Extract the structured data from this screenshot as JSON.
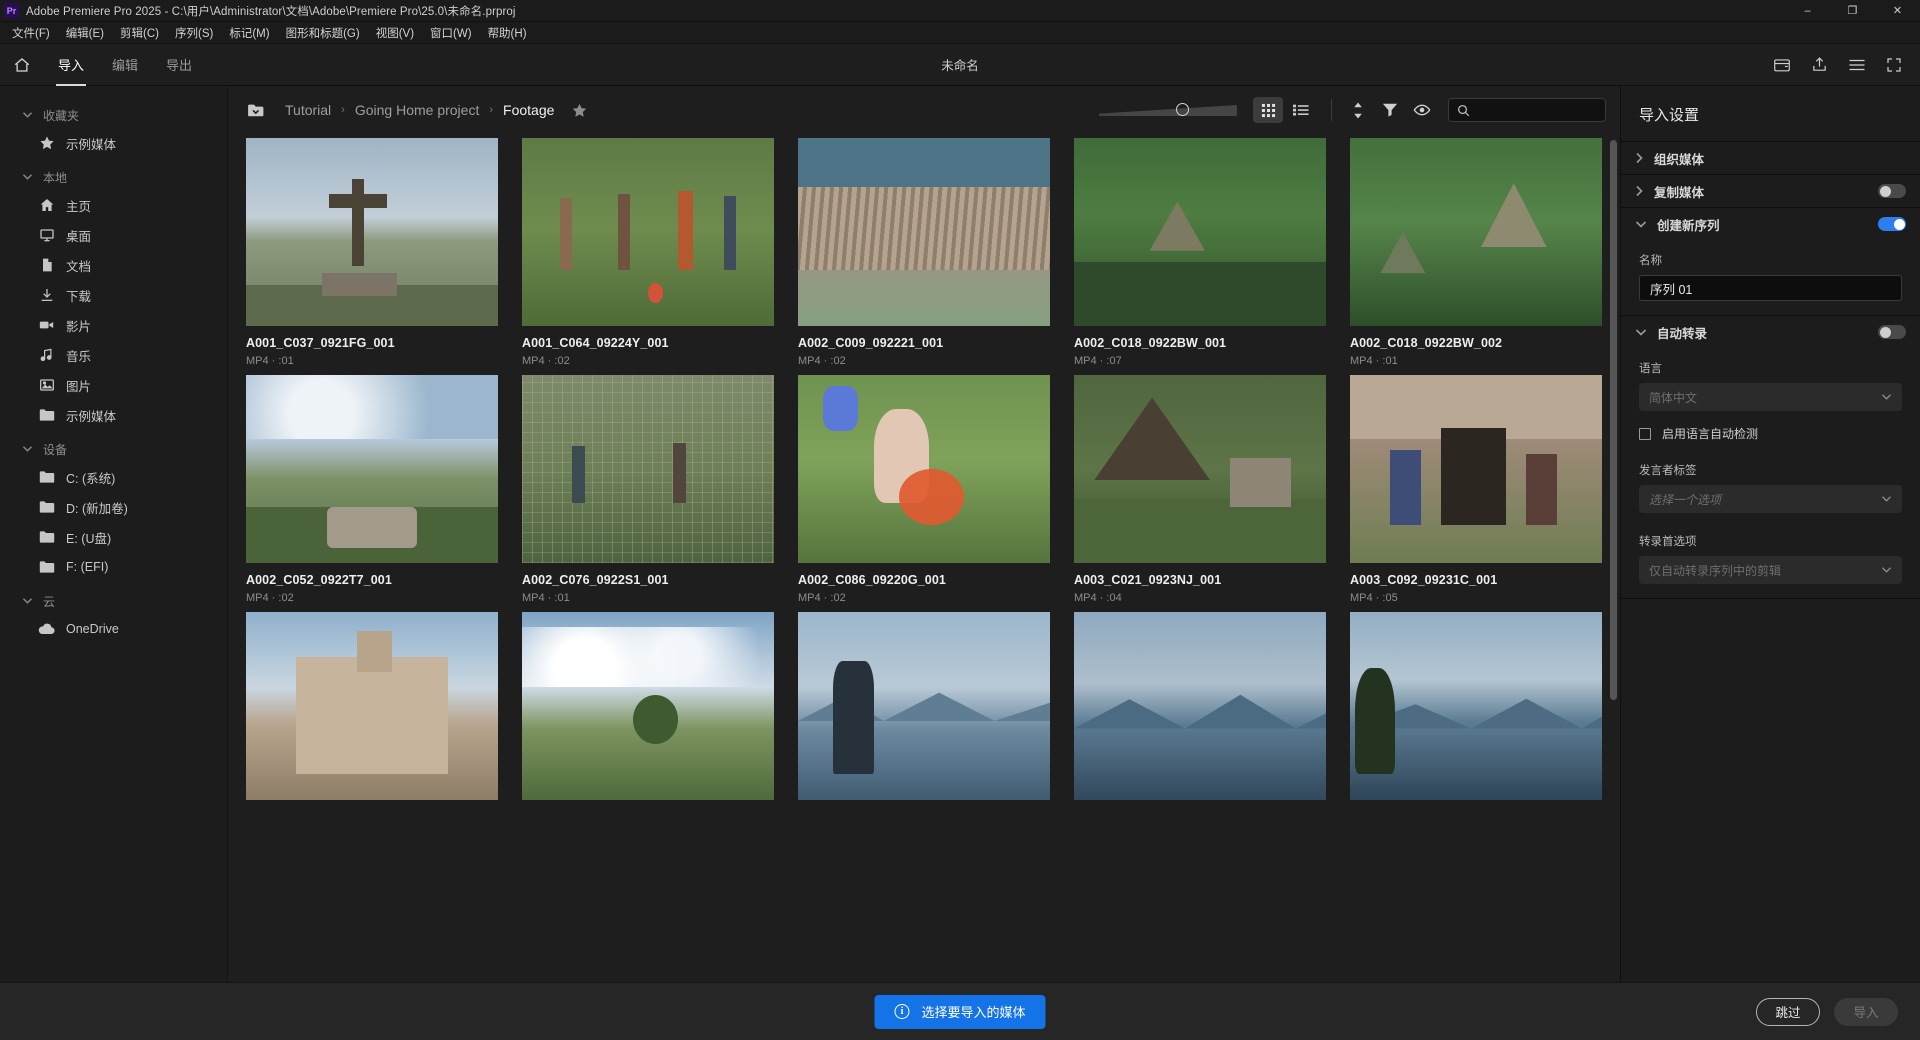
{
  "window": {
    "title": "Adobe Premiere Pro 2025 - C:\\用户\\Administrator\\文档\\Adobe\\Premiere Pro\\25.0\\未命名.prproj",
    "logo_text": "Pr",
    "minimize_label": "–",
    "maximize_label": "❐",
    "close_label": "✕"
  },
  "menubar": {
    "items": [
      {
        "label": "文件(F)"
      },
      {
        "label": "编辑(E)"
      },
      {
        "label": "剪辑(C)"
      },
      {
        "label": "序列(S)"
      },
      {
        "label": "标记(M)"
      },
      {
        "label": "图形和标题(G)"
      },
      {
        "label": "视图(V)"
      },
      {
        "label": "窗口(W)"
      },
      {
        "label": "帮助(H)"
      }
    ]
  },
  "topbar": {
    "home_icon": "home-icon",
    "tabs": [
      {
        "label": "导入",
        "active": true
      },
      {
        "label": "编辑",
        "active": false
      },
      {
        "label": "导出",
        "active": false
      }
    ],
    "document_title": "未命名",
    "right_icons": [
      "new-project-icon",
      "share-icon",
      "menu-icon",
      "fullscreen-icon"
    ]
  },
  "sidebar": {
    "groups": [
      {
        "title": "收藏夹",
        "items": [
          {
            "label": "示例媒体",
            "icon": "star-icon"
          }
        ]
      },
      {
        "title": "本地",
        "items": [
          {
            "label": "主页",
            "icon": "home-icon"
          },
          {
            "label": "桌面",
            "icon": "desktop-icon"
          },
          {
            "label": "文档",
            "icon": "document-icon"
          },
          {
            "label": "下载",
            "icon": "download-icon"
          },
          {
            "label": "影片",
            "icon": "video-camera-icon"
          },
          {
            "label": "音乐",
            "icon": "music-note-icon"
          },
          {
            "label": "图片",
            "icon": "picture-icon"
          },
          {
            "label": "示例媒体",
            "icon": "folder-icon"
          }
        ]
      },
      {
        "title": "设备",
        "items": [
          {
            "label": "C: (系统)",
            "icon": "folder-icon"
          },
          {
            "label": "D: (新加卷)",
            "icon": "folder-icon"
          },
          {
            "label": "E: (U盘)",
            "icon": "folder-icon"
          },
          {
            "label": "F: (EFI)",
            "icon": "folder-icon"
          }
        ]
      },
      {
        "title": "云",
        "items": [
          {
            "label": "OneDrive",
            "icon": "cloud-icon"
          }
        ]
      }
    ]
  },
  "breadcrumb": {
    "folder_icon": "folder-dropdown-icon",
    "separator": "›",
    "items": [
      {
        "label": "Tutorial",
        "current": false
      },
      {
        "label": "Going Home project",
        "current": false
      },
      {
        "label": "Footage",
        "current": true
      }
    ],
    "star_icon": "star-icon"
  },
  "toolbar": {
    "zoom_slider_value": 56,
    "grid_view_label": "grid-view-icon",
    "list_view_label": "list-view-icon",
    "sort_icon": "sort-icon",
    "filter_icon": "filter-icon",
    "eye_icon": "eye-icon",
    "search_icon": "search-icon",
    "search_value": "",
    "search_placeholder": ""
  },
  "media": {
    "items": [
      {
        "name": "A001_C037_0921FG_001",
        "meta": "MP4 · :01",
        "thumb": "cross-monument-hill"
      },
      {
        "name": "A001_C064_09224Y_001",
        "meta": "MP4 · :02",
        "thumb": "soccer-players-field"
      },
      {
        "name": "A002_C009_092221_001",
        "meta": "MP4 · :02",
        "thumb": "aerial-lakeside-town"
      },
      {
        "name": "A002_C018_0922BW_001",
        "meta": "MP4 · :07",
        "thumb": "aerial-jungle-ruins"
      },
      {
        "name": "A002_C018_0922BW_002",
        "meta": "MP4 · :01",
        "thumb": "aerial-jungle-temple"
      },
      {
        "name": "A002_C052_0922T7_001",
        "meta": "MP4 · :02",
        "thumb": "rock-overlook-valley"
      },
      {
        "name": "A002_C076_0922S1_001",
        "meta": "MP4 · :01",
        "thumb": "fence-people-field"
      },
      {
        "name": "A002_C086_09220G_001",
        "meta": "MP4 · :02",
        "thumb": "feet-water-splash-grass"
      },
      {
        "name": "A003_C021_0923NJ_001",
        "meta": "MP4 · :04",
        "thumb": "thatched-hut-ruins"
      },
      {
        "name": "A003_C092_09231C_001",
        "meta": "MP4 · :05",
        "thumb": "children-hut-doorway"
      },
      {
        "name": "",
        "meta": "",
        "thumb": "church-facade-tower"
      },
      {
        "name": "",
        "meta": "",
        "thumb": "lone-tree-clouds"
      },
      {
        "name": "",
        "meta": "",
        "thumb": "woman-lake-volcano"
      },
      {
        "name": "",
        "meta": "",
        "thumb": "lake-volcano-dusk"
      },
      {
        "name": "",
        "meta": "",
        "thumb": "lake-volcano-shore"
      }
    ]
  },
  "import_settings": {
    "title": "导入设置",
    "sections": [
      {
        "label": "组织媒体",
        "expanded": false,
        "has_toggle": false,
        "toggle_on": false
      },
      {
        "label": "复制媒体",
        "expanded": false,
        "has_toggle": true,
        "toggle_on": false
      },
      {
        "label": "创建新序列",
        "expanded": true,
        "has_toggle": true,
        "toggle_on": true
      },
      {
        "label": "自动转录",
        "expanded": true,
        "has_toggle": true,
        "toggle_on": false
      }
    ],
    "sequence": {
      "name_label": "名称",
      "name_value": "序列 01"
    },
    "transcription": {
      "language_label": "语言",
      "language_value": "简体中文",
      "auto_detect_label": "启用语言自动检测",
      "auto_detect_checked": false,
      "speaker_label": "发言者标签",
      "speaker_value": "选择一个选项",
      "pref_label": "转录首选项",
      "pref_value": "仅自动转录序列中的剪辑"
    },
    "accent_color": "#2d7ff0"
  },
  "footer": {
    "notice_icon": "info-icon",
    "notice_text": "选择要导入的媒体",
    "notice_color": "#1473e6",
    "skip_label": "跳过",
    "import_label": "导入"
  }
}
